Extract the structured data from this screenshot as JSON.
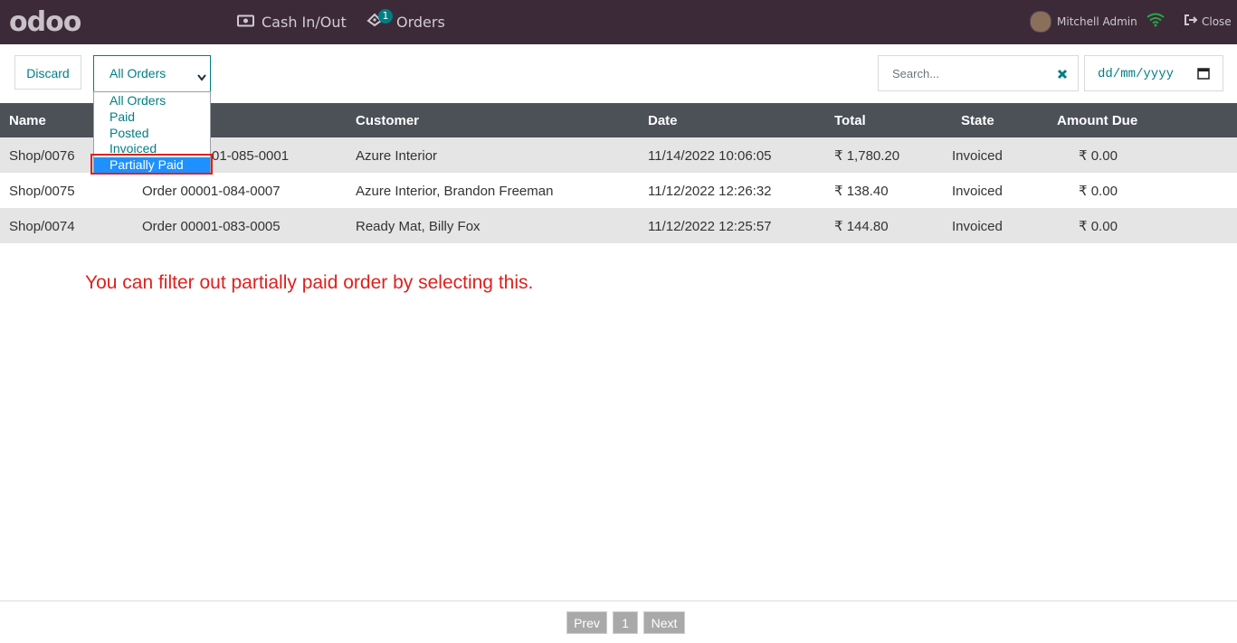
{
  "topbar": {
    "logo": "odoo",
    "cash_label": "Cash In/Out",
    "orders_label": "Orders",
    "orders_badge": "1",
    "user_name": "Mitchell Admin",
    "close_label": "Close"
  },
  "controls": {
    "discard_label": "Discard",
    "filter_selected": "All Orders",
    "filter_options": [
      "All Orders",
      "Paid",
      "Posted",
      "Invoiced",
      "Partially Paid"
    ],
    "search_placeholder": "Search...",
    "date_placeholder": "dd/mm/yyyy"
  },
  "table": {
    "headers": [
      "Name",
      "Customer",
      "Date",
      "Total",
      "State",
      "Amount Due"
    ],
    "rows": [
      {
        "name": "Shop/0076",
        "order": "01-085-0001",
        "customer": "Azure Interior",
        "date": "11/14/2022 10:06:05",
        "total": "₹ 1,780.20",
        "state": "Invoiced",
        "due": "₹ 0.00"
      },
      {
        "name": "Shop/0075",
        "order": "Order 00001-084-0007",
        "customer": "Azure Interior, Brandon Freeman",
        "date": "11/12/2022 12:26:32",
        "total": "₹ 138.40",
        "state": "Invoiced",
        "due": "₹ 0.00"
      },
      {
        "name": "Shop/0074",
        "order": "Order 00001-083-0005",
        "customer": "Ready Mat, Billy Fox",
        "date": "11/12/2022 12:25:57",
        "total": "₹ 144.80",
        "state": "Invoiced",
        "due": "₹ 0.00"
      }
    ]
  },
  "annotation": "You can filter out partially paid order by selecting this.",
  "pagination": {
    "prev": "Prev",
    "page": "1",
    "next": "Next"
  },
  "colors": {
    "topbar": "#3c2a39",
    "accent": "#017e84",
    "header_row": "#4c5057",
    "annotation": "#e0201d",
    "option_highlight": "#1e90ff"
  }
}
